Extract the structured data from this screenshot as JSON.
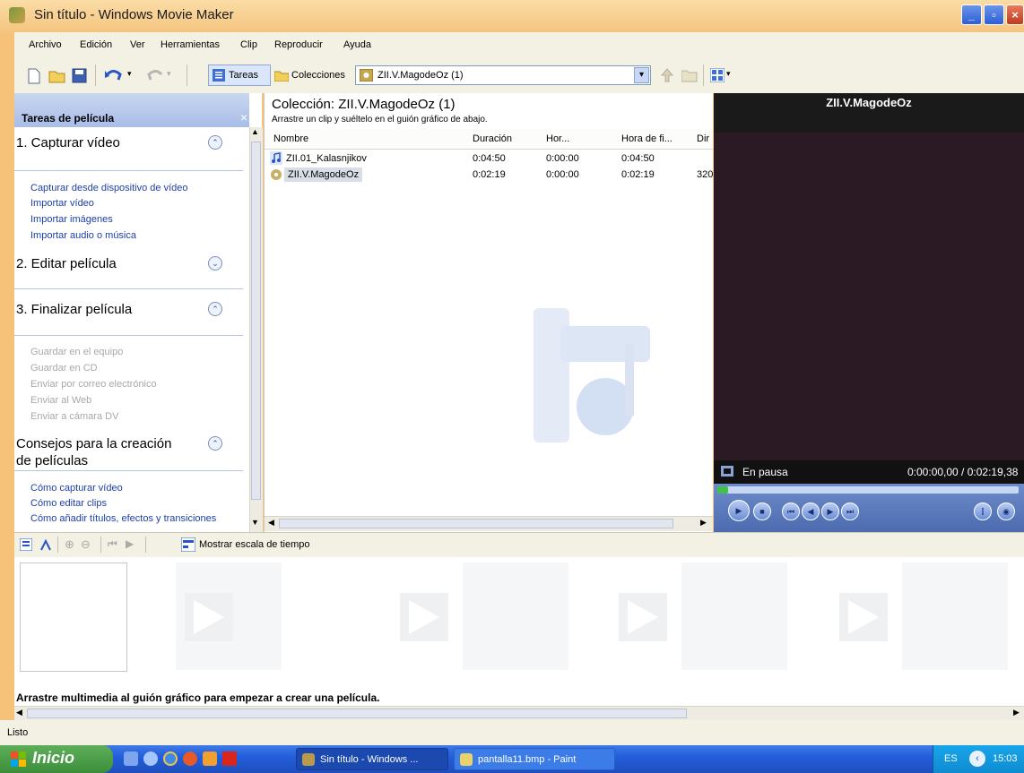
{
  "window": {
    "title": "Sin título - Windows Movie Maker",
    "controls": [
      "_",
      "▫",
      "×"
    ]
  },
  "menu": [
    "Archivo",
    "Edición",
    "Ver",
    "Herramientas",
    "Clip",
    "Reproducir",
    "Ayuda"
  ],
  "toolbar": {
    "tasks_label": "Tareas",
    "collections_label": "Colecciones",
    "collection_select": "ZII.V.MagodeOz (1)"
  },
  "tasks_pane": {
    "header": "Tareas de película",
    "close": "×",
    "sections": [
      {
        "title": "1. Capturar vídeo",
        "chevron": "⌃",
        "links": [
          "Capturar desde dispositivo de vídeo",
          "Importar vídeo",
          "Importar imágenes",
          "Importar audio o música"
        ]
      },
      {
        "title": "2. Editar película",
        "chevron": "⌄",
        "links": []
      },
      {
        "title": "3. Finalizar película",
        "chevron": "⌃",
        "links": [
          "Guardar en el equipo",
          "Guardar en CD",
          "Enviar por correo electrónico",
          "Enviar al Web",
          "Enviar a cámara DV"
        ]
      },
      {
        "title": "Consejos para la creación de películas",
        "title_line1": "Consejos para la creación",
        "title_line2": "de películas",
        "chevron": "⌃",
        "links": [
          "Cómo capturar vídeo",
          "Cómo editar clips",
          "Cómo añadir títulos, efectos y transiciones"
        ]
      }
    ]
  },
  "collection": {
    "title": "Colección: ZII.V.MagodeOz (1)",
    "subtitle": "Arrastre un clip y suéltelo en el guión gráfico de abajo.",
    "columns": [
      "Nombre",
      "Duración",
      "Hor...",
      "Hora de fi...",
      "Dir"
    ],
    "rows": [
      {
        "name": "ZII.01_Kalasnjikov",
        "duration": "0:04:50",
        "start": "0:00:00",
        "end": "0:04:50",
        "dir": ""
      },
      {
        "name": "ZII.V.MagodeOz",
        "duration": "0:02:19",
        "start": "0:00:00",
        "end": "0:02:19",
        "dir": "320"
      }
    ]
  },
  "preview": {
    "title": "ZII.V.MagodeOz",
    "status": "En pausa",
    "time": "0:00:00,00 / 0:02:19,38"
  },
  "storyboard": {
    "show_timeline_label": "Mostrar escala de tiempo",
    "hint": "Arrastre multimedia al guión gráfico para empezar a crear una película."
  },
  "statusbar": {
    "text": "Listo"
  },
  "taskbar": {
    "start": "Inicio",
    "tasks": [
      "Sin título - Windows ...",
      "pantalla11.bmp - Paint"
    ],
    "language": "ES",
    "clock": "15:03"
  },
  "colors": {
    "title_bar": "#f4c57f",
    "link": "#1c3fa8",
    "disabled_link": "#a8a8a8",
    "taskbar": "#245edb",
    "start_button": "#3c8f3a"
  }
}
